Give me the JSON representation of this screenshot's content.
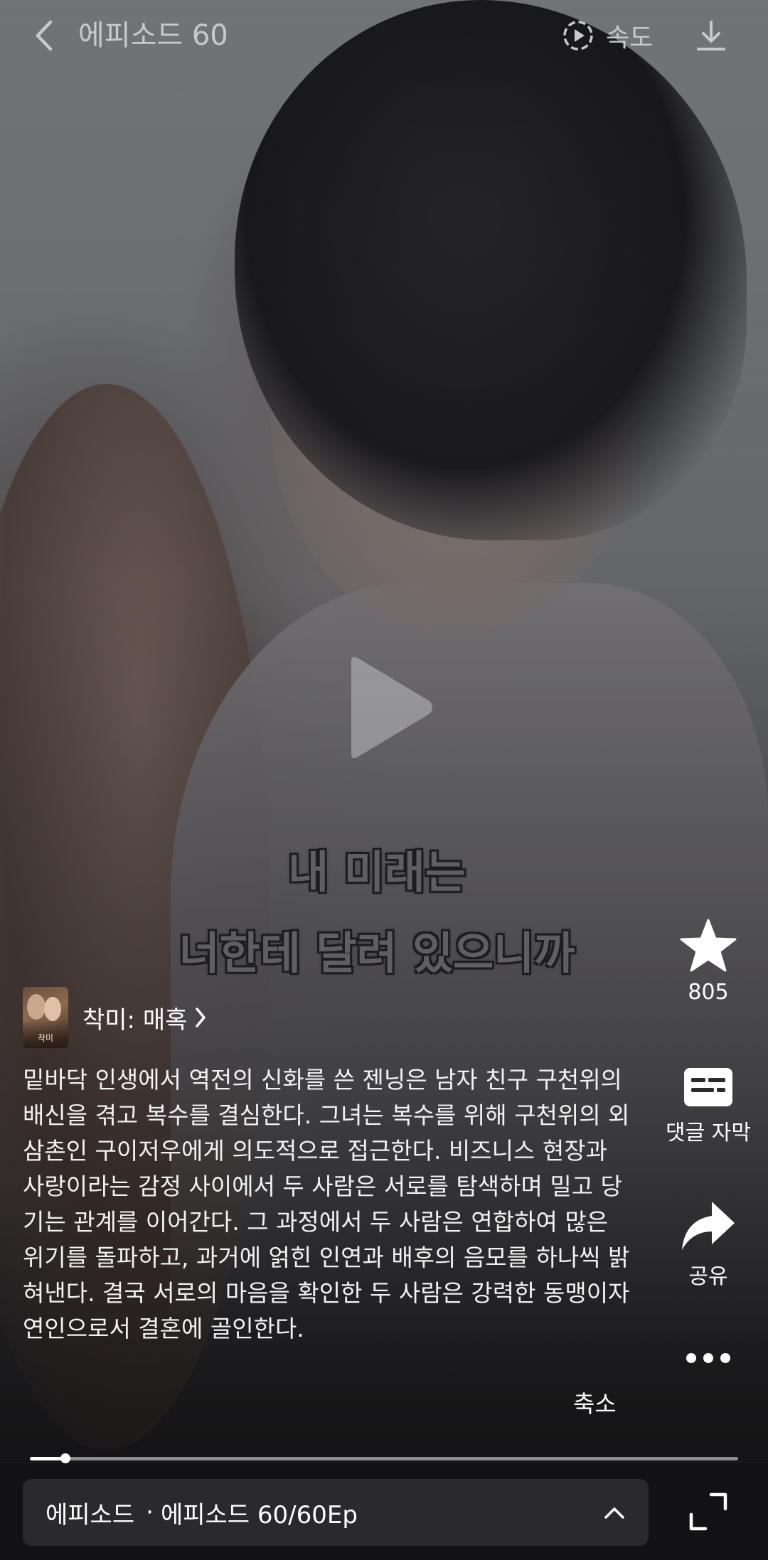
{
  "header": {
    "title": "에피소드 60",
    "speed_label": "속도"
  },
  "subtitles": [
    "내 미래는",
    "너한테 달려 있으니까"
  ],
  "actions": {
    "favorite_count": "805",
    "comment_subtitle_label": "댓글 자막",
    "share_label": "공유"
  },
  "series": {
    "name": "착미: 매혹",
    "thumbnail_text": "착미"
  },
  "synopsis": "밑바닥 인생에서 역전의 신화를 쓴 젠닝은 남자 친구 구천위의 배신을 겪고 복수를 결심한다. 그녀는 복수를 위해 구천위의 외삼촌인 구이저우에게 의도적으로 접근한다. 비즈니스 현장과 사랑이라는 감정 사이에서 두 사람은 서로를 탐색하며 밀고 당기는 관계를 이어간다. 그 과정에서 두 사람은 연합하여 많은 위기를 돌파하고, 과거에 얽힌 인연과 배후의 음모를 하나씩 밝혀낸다. 결국 서로의 마음을 확인한 두 사람은 강력한 동맹이자 연인으로서 결혼에 골인한다.",
  "collapse_label": "축소",
  "playback": {
    "progress": 0.05
  },
  "bottom_bar": {
    "episode_label": "에피소드",
    "separator": "·",
    "episode_value": "에피소드 60/60Ep"
  },
  "colors": {
    "bottom_bg": "#121214",
    "episode_bar_bg": "#2a2a2d",
    "progress_track": "#8f8f92"
  }
}
